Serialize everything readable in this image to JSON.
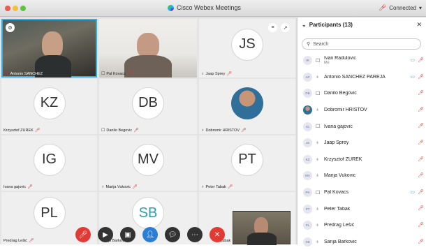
{
  "window": {
    "title": "Cisco Webex Meetings",
    "status": "Connected"
  },
  "tiles": [
    {
      "name": "Antonio SANCHEZ",
      "initials": ""
    },
    {
      "name": "Pal Kovacs",
      "initials": ""
    },
    {
      "name": "Jaap Sprey",
      "initials": "JS"
    },
    {
      "name": "Krzysztof ZUREK",
      "initials": "KZ"
    },
    {
      "name": "Danilo Begovic",
      "initials": "DB"
    },
    {
      "name": "Dobromir HRISTOV",
      "initials": ""
    },
    {
      "name": "Ivana gajovic",
      "initials": "IG"
    },
    {
      "name": "Marija Vukovic",
      "initials": "MV"
    },
    {
      "name": "Peter Tabak",
      "initials": "PT"
    },
    {
      "name": "Predrag Lešić",
      "initials": "PL"
    },
    {
      "name": "Sanja Barkovic",
      "initials": "SB"
    },
    {
      "name": "Zubak",
      "initials": ""
    }
  ],
  "panel": {
    "title": "Participants (13)",
    "search_placeholder": "Search",
    "participants": [
      {
        "initials": "IR",
        "name": "Ivan Radulovic",
        "sub": "Me"
      },
      {
        "initials": "AP",
        "name": "Antonio SANCHEZ PAREJA",
        "sub": ""
      },
      {
        "initials": "DB",
        "name": "Danilo Begovic",
        "sub": ""
      },
      {
        "initials": "",
        "name": "Dobromir HRISTOV",
        "sub": ""
      },
      {
        "initials": "IG",
        "name": "Ivana gajovic",
        "sub": ""
      },
      {
        "initials": "JS",
        "name": "Jaap Sprey",
        "sub": ""
      },
      {
        "initials": "KZ",
        "name": "Krzysztof ZUREK",
        "sub": ""
      },
      {
        "initials": "MV",
        "name": "Marija Vukovic",
        "sub": ""
      },
      {
        "initials": "PK",
        "name": "Pal Kovacs",
        "sub": ""
      },
      {
        "initials": "PT",
        "name": "Peter Tabak",
        "sub": ""
      },
      {
        "initials": "PL",
        "name": "Predrag Lešić",
        "sub": ""
      },
      {
        "initials": "SB",
        "name": "Sanja Barkovic",
        "sub": ""
      }
    ]
  },
  "colors": {
    "accent": "#31b0e6",
    "mute": "#d12d2d",
    "end": "#e23b36"
  }
}
